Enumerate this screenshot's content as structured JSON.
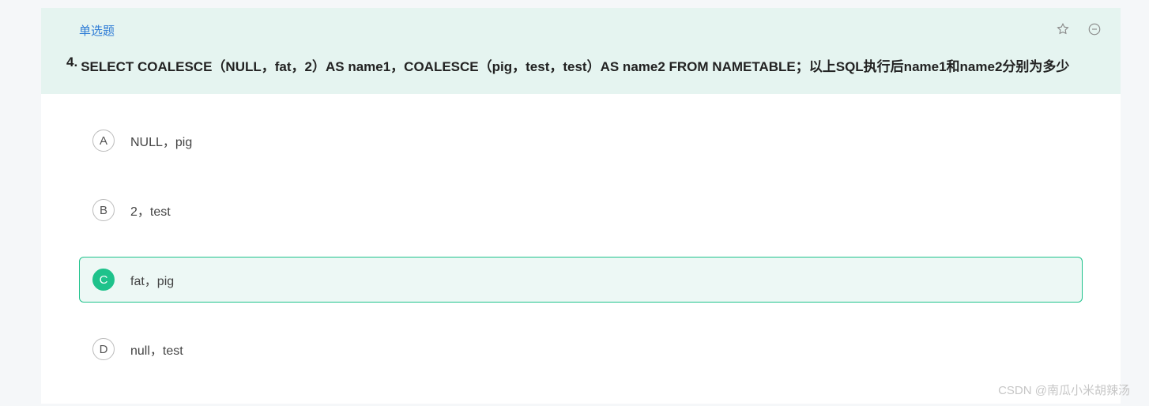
{
  "question": {
    "type_label": "单选题",
    "number": "4.",
    "text": "SELECT COALESCE（NULL，fat，2）AS name1，COALESCE（pig，test，test）AS name2 FROM NAMETABLE；以上SQL执行后name1和name2分别为多少"
  },
  "options": [
    {
      "letter": "A",
      "text": "NULL，pig",
      "selected": false
    },
    {
      "letter": "B",
      "text": "2，test",
      "selected": false
    },
    {
      "letter": "C",
      "text": "fat，pig",
      "selected": true
    },
    {
      "letter": "D",
      "text": "null，test",
      "selected": false
    }
  ],
  "watermark": "CSDN @南瓜小米胡辣汤"
}
